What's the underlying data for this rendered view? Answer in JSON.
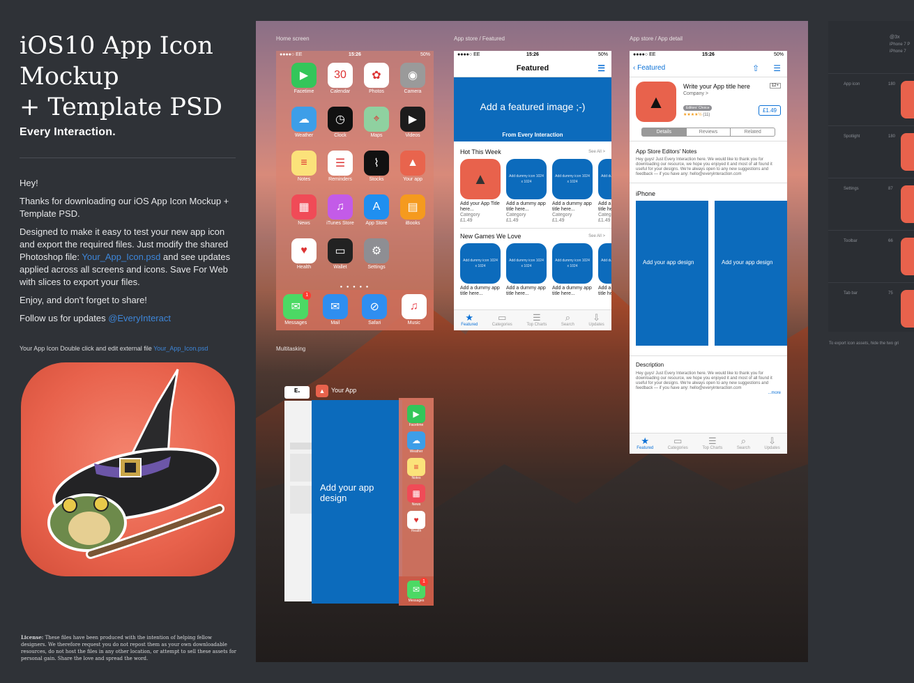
{
  "left": {
    "title_lines": [
      "iOS10 App Icon",
      "Mockup",
      "+ Template PSD"
    ],
    "brand": "Every Interaction.",
    "greeting": "Hey!",
    "para1": "Thanks for downloading our iOS App Icon Mockup + Template PSD.",
    "para2_pre": "Designed to make it easy to test your new app icon and export the required files. Just modify the shared Photoshop file: ",
    "para2_link": "Your_App_Icon.psd",
    "para2_post": " and see updates applied across all screens and icons. Save For Web with slices to export your files.",
    "para3": "Enjoy, and don't forget to share!",
    "para4_pre": "Follow us for updates ",
    "para4_link": "@EveryInteract",
    "caption_pre": "Your App Icon Double click and edit external file ",
    "caption_link": "Your_App_Icon.psd",
    "license_label": "License:",
    "license_text": " These files have been produced with the intention of helping fellow designers. We therefore request you do not repost them as your own downloadable resources, do not host the files in any other location, or attempt to sell these assets for personal gain. Share the love and spread the word."
  },
  "sections": {
    "home": "Home screen",
    "featured": "App store / Featured",
    "detail": "App store / App detail",
    "multitasking": "Multitasking"
  },
  "statusbar": {
    "carrier": "●●●●○ EE",
    "time": "15:26",
    "battery": "50%"
  },
  "home": {
    "apps": [
      {
        "label": "Facetime",
        "icon": "video-icon",
        "glyph": "▶",
        "color": "#33c65a"
      },
      {
        "label": "Calendar",
        "icon": "calendar-icon",
        "glyph": "30",
        "color": "#ffffff"
      },
      {
        "label": "Photos",
        "icon": "photos-icon",
        "glyph": "✿",
        "color": "#ffffff"
      },
      {
        "label": "Camera",
        "icon": "camera-icon",
        "glyph": "◉",
        "color": "#9a9a9a"
      },
      {
        "label": "Weather",
        "icon": "weather-icon",
        "glyph": "☁",
        "color": "#3d9ee8"
      },
      {
        "label": "Clock",
        "icon": "clock-icon",
        "glyph": "◷",
        "color": "#111111"
      },
      {
        "label": "Maps",
        "icon": "maps-icon",
        "glyph": "⌖",
        "color": "#8fd1a0"
      },
      {
        "label": "Videos",
        "icon": "videos-icon",
        "glyph": "▶",
        "color": "#1c1c1c"
      },
      {
        "label": "Notes",
        "icon": "notes-icon",
        "glyph": "≡",
        "color": "#fbe27a"
      },
      {
        "label": "Reminders",
        "icon": "reminders-icon",
        "glyph": "☰",
        "color": "#ffffff"
      },
      {
        "label": "Stocks",
        "icon": "stocks-icon",
        "glyph": "⌇",
        "color": "#111111"
      },
      {
        "label": "Your app",
        "icon": "your-app-icon",
        "glyph": "▲",
        "color": "#e8644d"
      },
      {
        "label": "News",
        "icon": "news-icon",
        "glyph": "▦",
        "color": "#f04b57"
      },
      {
        "label": "iTunes Store",
        "icon": "itunes-icon",
        "glyph": "♫",
        "color": "#c35be8"
      },
      {
        "label": "App Store",
        "icon": "appstore-icon",
        "glyph": "A",
        "color": "#1f8ff0"
      },
      {
        "label": "iBooks",
        "icon": "ibooks-icon",
        "glyph": "▤",
        "color": "#f59a1e"
      },
      {
        "label": "Health",
        "icon": "health-icon",
        "glyph": "♥",
        "color": "#ffffff"
      },
      {
        "label": "Wallet",
        "icon": "wallet-icon",
        "glyph": "▭",
        "color": "#222222"
      },
      {
        "label": "Settings",
        "icon": "settings-icon",
        "glyph": "⚙",
        "color": "#8e8e93"
      }
    ],
    "dock": [
      {
        "label": "Messages",
        "icon": "messages-icon",
        "glyph": "✉",
        "color": "#4cd964",
        "badge": "1"
      },
      {
        "label": "Mail",
        "icon": "mail-icon",
        "glyph": "✉",
        "color": "#2f8ef0",
        "badge": ""
      },
      {
        "label": "Safari",
        "icon": "safari-icon",
        "glyph": "⊘",
        "color": "#2f8ef0",
        "badge": ""
      },
      {
        "label": "Music",
        "icon": "music-icon",
        "glyph": "♫",
        "color": "#ffffff",
        "badge": ""
      }
    ]
  },
  "featured": {
    "nav_title": "Featured",
    "banner_text": "Add a featured image ;-)",
    "banner_sub": "From Every Interaction",
    "hot_title": "Hot This Week",
    "see_all": "See All >",
    "hot_cards": [
      {
        "title": "Add your App Title here...",
        "cat": "Category",
        "price": "£1.49",
        "placeholder": ""
      },
      {
        "title": "Add a dummy app title here...",
        "cat": "Category",
        "price": "£1.49",
        "placeholder": "Add dummy icon 1024 x 1024"
      },
      {
        "title": "Add a dummy app title here...",
        "cat": "Category",
        "price": "£1.49",
        "placeholder": "Add dummy icon 1024 x 1024"
      },
      {
        "title": "Add a dummy app title here...",
        "cat": "Category",
        "price": "£1.49",
        "placeholder": "Add dummy icon 1024 x 1024"
      }
    ],
    "games_title": "New Games We Love",
    "game_cards": [
      {
        "title": "Add a dummy app title here...",
        "placeholder": "Add dummy icon 1024 x 1024"
      },
      {
        "title": "Add a dummy app title here...",
        "placeholder": "Add dummy icon 1024 x 1024"
      },
      {
        "title": "Add a dummy app title here...",
        "placeholder": "Add dummy icon 1024 x 1024"
      },
      {
        "title": "Add a dummy app title here...",
        "placeholder": "Add dummy icon 1024 x 1024"
      }
    ]
  },
  "tabbar": [
    {
      "label": "Featured",
      "icon": "star-icon",
      "glyph": "★"
    },
    {
      "label": "Categories",
      "icon": "categories-icon",
      "glyph": "▭"
    },
    {
      "label": "Top Charts",
      "icon": "topcharts-icon",
      "glyph": "☰"
    },
    {
      "label": "Search",
      "icon": "search-icon",
      "glyph": "⌕"
    },
    {
      "label": "Updates",
      "icon": "updates-icon",
      "glyph": "⇩"
    }
  ],
  "detail": {
    "back_label": "Featured",
    "app_title": "Write your App title here",
    "company": "Company >",
    "age": "12+",
    "editors": "Editors' Choice",
    "rating": "★★★★½",
    "rating_count": "(11)",
    "price": "£1.49",
    "tabs": [
      "Details",
      "Reviews",
      "Related"
    ],
    "notes_title": "App Store Editors' Notes",
    "notes_text": "Hey guys! Just Every Interaction here. We would like to thank you for downloading our resource, we hope you enjoyed it and most of all found it useful for your designs. We're always open to any new suggestions and feedback — if you have any: hello@everyinteraction.com",
    "iphone_title": "iPhone",
    "screenshot_label": "Add your app design",
    "desc_title": "Description",
    "desc_text": "Hey guys! Just Every Interaction here. We would like to thank you for downloading our resource, we hope you enjoyed it and most of all found it useful for your designs. We're always open to any new suggestions and feedback — if you have any: hello@everyinteraction.com",
    "more": "...more"
  },
  "multitask": {
    "app_label": "Your App",
    "card_label": "Add your app design",
    "mini_apps": [
      {
        "label": "Facetime",
        "color": "#33c65a",
        "glyph": "▶"
      },
      {
        "label": "Weather",
        "color": "#3d9ee8",
        "glyph": "☁"
      },
      {
        "label": "Notes",
        "color": "#fbe27a",
        "glyph": "≡"
      },
      {
        "label": "News",
        "color": "#f04b57",
        "glyph": "▦"
      },
      {
        "label": "Health",
        "color": "#ffffff",
        "glyph": "♥"
      }
    ],
    "dock_label": "Messages"
  },
  "right_panel": {
    "header": "@3x",
    "sub1": "iPhone 7 P",
    "sub2": "iPhone 7",
    "rows": [
      {
        "label": "App icon",
        "size": "180"
      },
      {
        "label": "Spotlight",
        "size": "180"
      },
      {
        "label": "Settings",
        "size": "87"
      },
      {
        "label": "Toolbar",
        "size": "66"
      },
      {
        "label": "Tab bar",
        "size": "75"
      }
    ],
    "footnote": "To export icon assets, hide the two gri"
  },
  "colors": {
    "accent_blue": "#0c6bbc",
    "link": "#3d86d9",
    "icon_red": "#e8624c"
  }
}
